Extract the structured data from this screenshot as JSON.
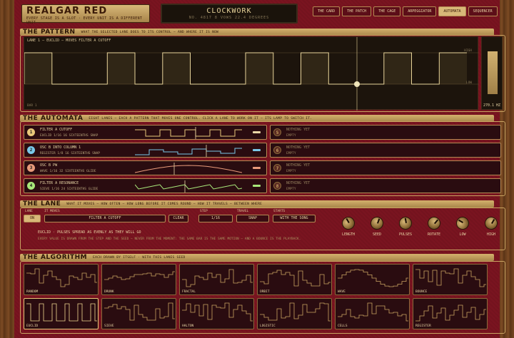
{
  "header": {
    "brand_title": "REALGAR RED",
    "brand_subtitle": "EVERY STAGE IS A SLOT · EVERY UNIT IS A DIFFERENT UNIT",
    "preset_name": "CLOCKWORK",
    "preset_meta": "NO. 4817   8 VOWS   22.4 DEGREES",
    "tabs": [
      "THE CARD",
      "THE PATCH",
      "THE CAGE",
      "ARPEGGIATOR",
      "AUTOMATA",
      "SEQUENCER"
    ],
    "active_tab": "AUTOMATA"
  },
  "pattern": {
    "title": "THE PATTERN",
    "desc": "WHAT THE SELECTED LANE DOES TO ITS CONTROL — AND WHERE IT IS NOW",
    "lane_label": "LANE 1  —  EUCLID  —  MOVES FILTER A CUTOFF",
    "bar_label": "BAR 1",
    "high": "HIGH",
    "low": "LOW",
    "freq": "270.1 HZ",
    "steps": [
      1,
      0,
      0,
      1,
      0,
      1,
      0,
      0,
      1,
      0,
      1,
      0,
      0,
      1,
      0,
      1
    ]
  },
  "automata": {
    "title": "THE AUTOMATA",
    "desc": "EIGHT LANES — EACH A PATTERN THAT MOVES ONE CONTROL. CLICK A LANE TO WORK ON IT — ITS LAMP TO SWITCH IT.",
    "lanes": [
      {
        "num": "1",
        "name": "FILTER A CUTOFF",
        "info": "EUCLID  1/16  16 SIXTEENTHS  SNAP",
        "color": "#e8c87a",
        "chip": "#e9d6a6"
      },
      {
        "num": "2",
        "name": "OSC B INTO COLUMN 1",
        "info": "REGISTER  1/8  16 SIXTEENTHS  SNAP",
        "color": "#7ac8e8",
        "chip": "#7ac8e8"
      },
      {
        "num": "3",
        "name": "OSC B PW",
        "info": "WAVE  1/16  32 SIXTEENTHS  GLIDE",
        "color": "#e89a7a",
        "chip": "#e89a7a"
      },
      {
        "num": "4",
        "name": "FILTER A RESONANCE",
        "info": "SIEVE  1/16  24 SIXTEENTHS  GLIDE",
        "color": "#a8e87a",
        "chip": "#a8e87a"
      }
    ],
    "empty_lanes": [
      {
        "num": "5",
        "name": "NOTHING YET",
        "info": "EMPTY"
      },
      {
        "num": "6",
        "name": "NOTHING YET",
        "info": "EMPTY"
      },
      {
        "num": "7",
        "name": "NOTHING YET",
        "info": "EMPTY"
      },
      {
        "num": "8",
        "name": "NOTHING YET",
        "info": "EMPTY"
      }
    ]
  },
  "lane": {
    "title": "THE LANE",
    "desc": "WHAT IT MOVES — HOW OFTEN — HOW LONG BEFORE IT COMES ROUND — HOW IT TRAVELS — BETWEEN WHERE",
    "lane_label": "LANE",
    "on": "ON",
    "moves_label": "IT MOVES",
    "moves_value": "FILTER A CUTOFF",
    "clear": "CLEAR",
    "step_label": "STEP",
    "step_value": "1/16",
    "travel_label": "TRAVEL",
    "travel_value": "SNAP",
    "starts_label": "STARTS",
    "starts_value": "WITH THE SONG",
    "knobs": [
      "LENGTH",
      "SEED",
      "PULSES",
      "ROTATE",
      "LOW",
      "HIGH"
    ],
    "info_line1": "EUCLID · PULSES SPREAD AS EVENLY AS THEY WILL GO",
    "info_line2": "EVERY VALUE IS DRAWN FROM THE STEP AND THE SEED — NEVER FROM THE MOMENT: THE SAME BAR IS THE SAME MOTION — AND A BOUNCE IS THE PLAYBACK."
  },
  "algorithm": {
    "title": "THE ALGORITHM",
    "desc": "EACH DRAWN BY ITSELF · WITH THIS LANES SEED",
    "tiles": [
      "RANDOM",
      "DRUNK",
      "FRACTAL",
      "ORBIT",
      "WAVE",
      "BOUNCE",
      "EUCLID",
      "SIEVE",
      "HALTON",
      "LOGISTIC",
      "CELLS",
      "REGISTER"
    ],
    "active": "EUCLID"
  }
}
